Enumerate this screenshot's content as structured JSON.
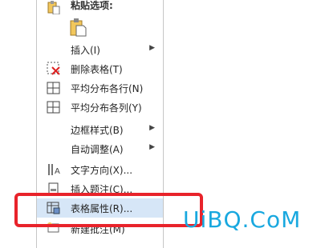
{
  "menu": {
    "paste_header": "粘贴选项:",
    "items": [
      {
        "label": "插入(I)",
        "has_submenu": true,
        "icon": "none"
      },
      {
        "label": "删除表格(T)",
        "has_submenu": false,
        "icon": "delete-table-icon"
      },
      {
        "label": "平均分布各行(N)",
        "has_submenu": false,
        "icon": "distribute-rows-icon"
      },
      {
        "label": "平均分布各列(Y)",
        "has_submenu": false,
        "icon": "distribute-columns-icon"
      },
      {
        "label": "边框样式(B)",
        "has_submenu": true,
        "icon": "none"
      },
      {
        "label": "自动调整(A)",
        "has_submenu": true,
        "icon": "none"
      },
      {
        "label": "文字方向(X)...",
        "has_submenu": false,
        "icon": "text-direction-icon"
      },
      {
        "label": "插入题注(C)...",
        "has_submenu": false,
        "icon": "insert-caption-icon"
      },
      {
        "label": "表格属性(R)...",
        "has_submenu": false,
        "icon": "table-properties-icon",
        "highlighted": true
      },
      {
        "label": "新建批注(M)",
        "has_submenu": false,
        "icon": "new-comment-icon"
      }
    ]
  },
  "watermark": {
    "text": "UiBQ.CoM"
  },
  "colors": {
    "highlight": "#d6e6f7",
    "annotation_box": "#e8232b",
    "watermark": "#19a8df"
  }
}
